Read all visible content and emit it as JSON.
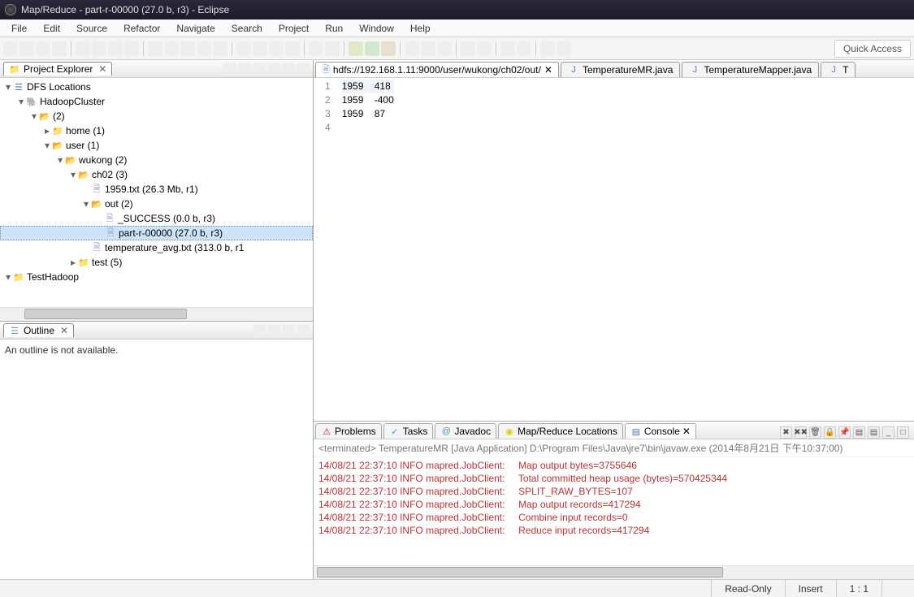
{
  "title": "Map/Reduce - part-r-00000 (27.0 b, r3) - Eclipse",
  "menu": [
    "File",
    "Edit",
    "Source",
    "Refactor",
    "Navigate",
    "Search",
    "Project",
    "Run",
    "Window",
    "Help"
  ],
  "quick_access": "Quick Access",
  "project_explorer": {
    "title": "Project Explorer"
  },
  "tree": {
    "dfs": "DFS Locations",
    "cluster": "HadoopCluster",
    "root_folder": "(2)",
    "home": "home (1)",
    "user": "user (1)",
    "wukong": "wukong (2)",
    "ch02": "ch02 (3)",
    "file1959": "1959.txt (26.3 Mb, r1)",
    "out": "out (2)",
    "success": "_SUCCESS (0.0 b, r3)",
    "part": "part-r-00000 (27.0 b, r3)",
    "tempavg": "temperature_avg.txt (313.0 b, r1",
    "test": "test (5)",
    "testhadoop": "TestHadoop"
  },
  "outline": {
    "title": "Outline",
    "msg": "An outline is not available."
  },
  "editor": {
    "tab1": "hdfs://192.168.1.11:9000/user/wukong/ch02/out/",
    "tab2": "TemperatureMR.java",
    "tab3": "TemperatureMapper.java",
    "tab4": "T",
    "lines": [
      "1959    418",
      "1959    -400",
      "1959    87",
      ""
    ]
  },
  "bottom_tabs": {
    "problems": "Problems",
    "tasks": "Tasks",
    "javadoc": "Javadoc",
    "mapred": "Map/Reduce Locations",
    "console": "Console"
  },
  "console": {
    "desc": "<terminated> TemperatureMR [Java Application] D:\\Program Files\\Java\\jre7\\bin\\javaw.exe (2014年8月21日 下午10:37:00)",
    "lines": [
      "14/08/21 22:37:10 INFO mapred.JobClient:     Map output bytes=3755646",
      "14/08/21 22:37:10 INFO mapred.JobClient:     Total committed heap usage (bytes)=570425344",
      "14/08/21 22:37:10 INFO mapred.JobClient:     SPLIT_RAW_BYTES=107",
      "14/08/21 22:37:10 INFO mapred.JobClient:     Map output records=417294",
      "14/08/21 22:37:10 INFO mapred.JobClient:     Combine input records=0",
      "14/08/21 22:37:10 INFO mapred.JobClient:     Reduce input records=417294"
    ]
  },
  "status": {
    "readonly": "Read-Only",
    "insert": "Insert",
    "pos": "1 : 1"
  }
}
